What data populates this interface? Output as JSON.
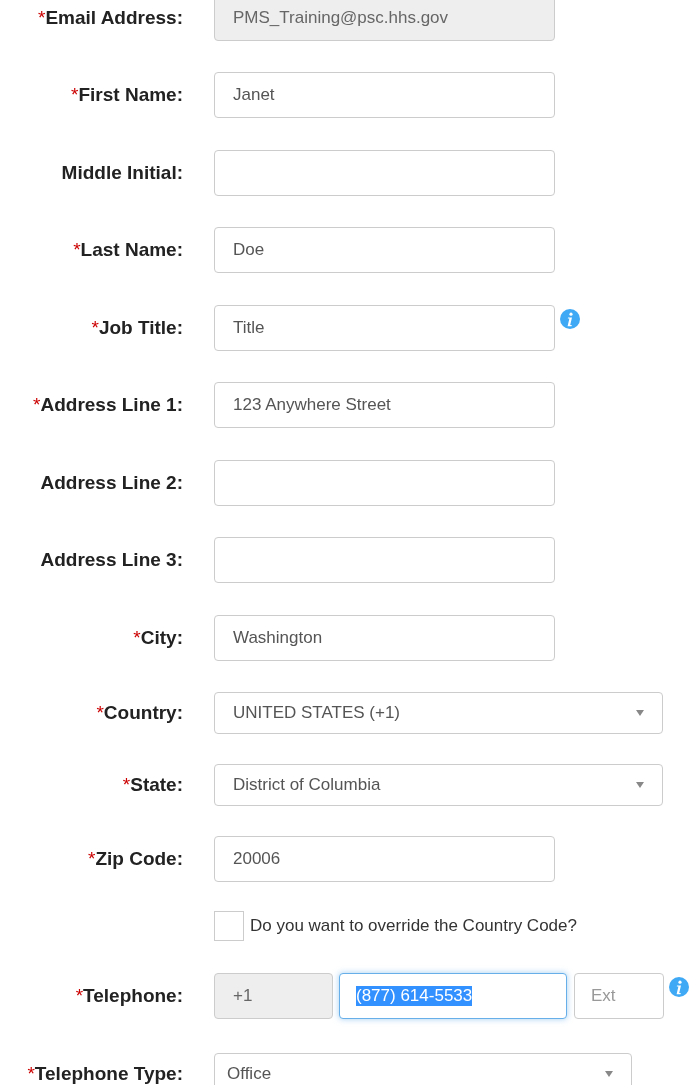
{
  "fields": [
    {
      "kind": "text",
      "marker": "*",
      "label": "Email Address:",
      "value": "PMS_Training@psc.hhs.gov",
      "disabled": true
    },
    {
      "kind": "text",
      "marker": "*",
      "label": "First Name:",
      "value": "Janet",
      "disabled": false
    },
    {
      "kind": "text",
      "label": "Middle Initial:",
      "disabled": false
    },
    {
      "kind": "text",
      "marker": "*",
      "label": "Last Name:",
      "value": "Doe",
      "disabled": false
    },
    {
      "kind": "text",
      "marker": "*",
      "label": "Job Title:",
      "value": "Title",
      "disabled": false,
      "info": true
    },
    {
      "kind": "text",
      "marker": "*",
      "label": "Address Line 1:",
      "value": "123 Anywhere Street",
      "disabled": false
    },
    {
      "kind": "text",
      "label": "Address Line 2:",
      "disabled": false
    },
    {
      "kind": "text",
      "label": "Address Line 3:",
      "disabled": false
    },
    {
      "kind": "text",
      "marker": "*",
      "label": "City:",
      "value": "Washington",
      "disabled": false
    },
    {
      "kind": "select",
      "marker": "*",
      "label": "Country:",
      "value": "UNITED STATES (+1)",
      "narrow": false
    },
    {
      "kind": "select",
      "marker": "*",
      "label": "State:",
      "value": "District of Columbia",
      "narrow": false
    },
    {
      "kind": "text",
      "marker": "*",
      "label": "Zip Code:",
      "value": "20006",
      "disabled": false
    },
    {
      "kind": "checkbox",
      "text": "Do you want to override the Country Code?",
      "checked": false
    },
    {
      "kind": "phone",
      "marker": "*",
      "label": "Telephone:",
      "code": "+1",
      "value": "(877) 614-5533",
      "value_selected": true,
      "ext_placeholder": "Ext",
      "info": true
    },
    {
      "kind": "select",
      "marker": "*",
      "label": "Telephone Type:",
      "value": "Office",
      "narrow": true
    }
  ]
}
